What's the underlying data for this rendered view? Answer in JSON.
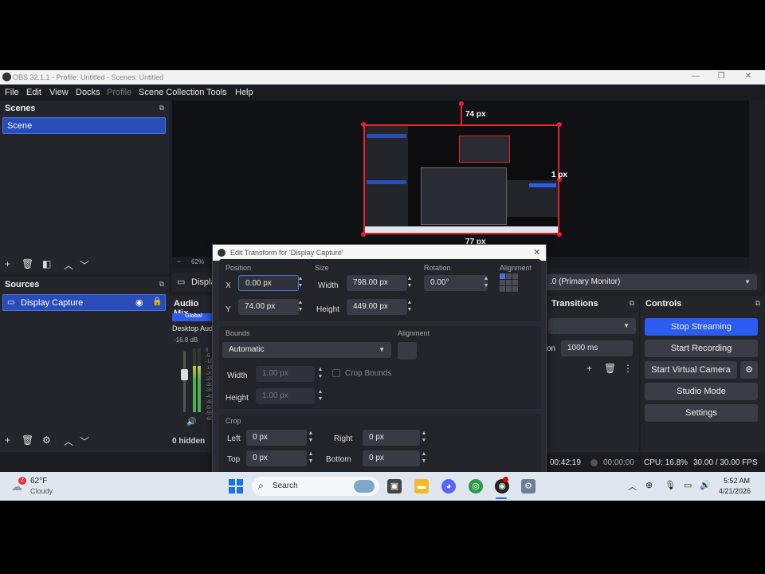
{
  "window": {
    "title": "OBS 32.1.1 - Profile: Untitled - Scenes: Untitled",
    "minimize": "—",
    "maximize": "❐",
    "close": "✕"
  },
  "menu": [
    "File",
    "Edit",
    "View",
    "Docks",
    "Profile",
    "Scene Collection",
    "Tools",
    "Help"
  ],
  "scenes": {
    "header": "Scenes",
    "items": [
      "Scene"
    ]
  },
  "sources": {
    "header": "Sources",
    "items": [
      "Display Capture"
    ]
  },
  "preview": {
    "top_measure": "74 px",
    "right_measure": "1 px",
    "bottom_measure": "77 px",
    "zoom": "62%"
  },
  "source_bar": {
    "name": "Displa",
    "monitor": ".0 (Primary Monitor)"
  },
  "audio_mixer": {
    "header": "Audio Mix",
    "badge": "Global",
    "channel": "Desktop Aud",
    "level": "-16.8 dB",
    "scale": [
      "0",
      "-5",
      "-10",
      "-15",
      "-20",
      "-25",
      "-30",
      "-35",
      "-40",
      "-45",
      "-50",
      "-55",
      "-60"
    ],
    "level_fraction": 0.72,
    "hidden": "0 hidden"
  },
  "transitions": {
    "header": "Transitions",
    "duration_label": "on",
    "duration": "1000 ms"
  },
  "controls": {
    "header": "Controls",
    "buttons": [
      "Stop Streaming",
      "Start Recording",
      "Start Virtual Camera",
      "Studio Mode",
      "Settings"
    ]
  },
  "dialog": {
    "title": "Edit Transform for 'Display Capture'",
    "position_label": "Position",
    "size_label": "Size",
    "rotation_label": "Rotation",
    "alignment_label": "Alignment",
    "x_label": "X",
    "x_value": "0.00 px",
    "y_label": "Y",
    "y_value": "74.00 px",
    "width_label": "Width",
    "width_value": "798.00 px",
    "height_label": "Height",
    "height_value": "449.00 px",
    "rotation_value": "0.00°",
    "bounds_label": "Bounds",
    "bounds_type": "Automatic",
    "bounds_alignment_label": "Alignment",
    "bounds_width_label": "Width",
    "bounds_width": "1.00 px",
    "bounds_height_label": "Height",
    "bounds_height": "1.00 px",
    "crop_bounds_label": "Crop Bounds",
    "crop_label": "Crop",
    "left_label": "Left",
    "left_value": "0 px",
    "right_label": "Right",
    "right_value": "0 px",
    "top_label": "Top",
    "top_value": "0 px",
    "bottom_label": "Bottom",
    "bottom_value": "0 px"
  },
  "status": {
    "rec_time": "00:42:19",
    "stream_time": "00:00:00",
    "cpu": "CPU: 16.8%",
    "fps": "30.00 / 30.00 FPS"
  },
  "taskbar": {
    "weather_badge": "2",
    "temp": "62°F",
    "condition": "Cloudy",
    "search": "Search",
    "time": "5:52 AM",
    "date": "4/21/2026"
  },
  "colors": {
    "accent": "#2b5bf0",
    "selection": "#284cb8",
    "bounding_box": "#e8222c"
  }
}
